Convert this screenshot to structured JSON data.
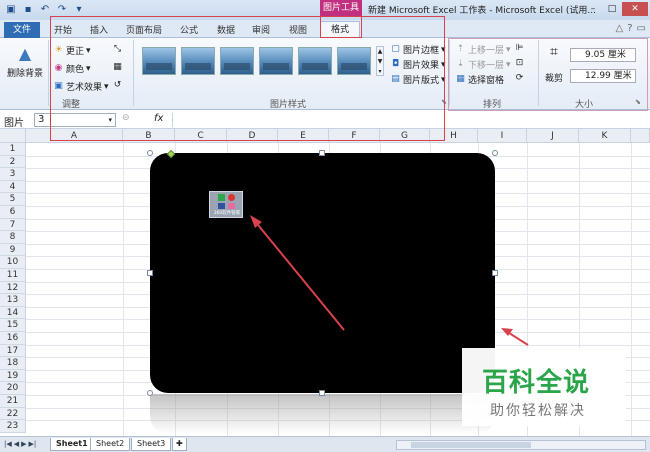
{
  "window": {
    "title": "新建 Microsoft Excel 工作表 - Microsoft Excel (试用...",
    "context_tab": "图片工具"
  },
  "tabs": {
    "file": "文件",
    "items": [
      "开始",
      "插入",
      "页面布局",
      "公式",
      "数据",
      "审阅",
      "视图"
    ],
    "active": "格式"
  },
  "ribbon": {
    "remove_bg": "删除背景",
    "adjust": {
      "corrections": "更正",
      "color": "颜色",
      "artistic": "艺术效果",
      "label": "调整"
    },
    "styles": {
      "label": "图片样式"
    },
    "picture_opts": {
      "border": "图片边框",
      "effects": "图片效果",
      "layout": "图片版式"
    },
    "arrange": {
      "bring_forward": "上移一层",
      "send_backward": "下移一层",
      "selection_pane": "选择窗格",
      "label": "排列"
    },
    "size": {
      "crop": "裁剪",
      "height": "9.05 厘米",
      "width": "12.99 厘米",
      "label": "大小"
    }
  },
  "formula_bar": {
    "name_label": "图片",
    "name_value": "3",
    "fx": "fx"
  },
  "grid": {
    "columns": [
      "A",
      "B",
      "C",
      "D",
      "E",
      "F",
      "G",
      "H",
      "I",
      "J",
      "K"
    ],
    "rows": [
      "1",
      "2",
      "3",
      "4",
      "5",
      "6",
      "7",
      "8",
      "9",
      "10",
      "11",
      "12",
      "13",
      "14",
      "15",
      "16",
      "17",
      "18",
      "19",
      "20",
      "21",
      "22",
      "23"
    ]
  },
  "picture": {
    "cutout_caption": "360软件管家"
  },
  "sheets": {
    "tabs": [
      "Sheet1",
      "Sheet2",
      "Sheet3"
    ]
  },
  "watermark": {
    "title": "百科全说",
    "subtitle": "助你轻松解决"
  },
  "colors": {
    "context_tab": "#c0307f",
    "file_tab": "#2e6db4",
    "annotation_red": "#d9424c",
    "watermark_green": "#2aa54a"
  }
}
